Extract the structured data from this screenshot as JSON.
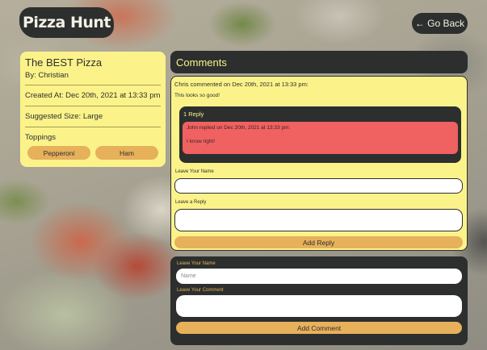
{
  "header": {
    "logo_text": "Pizza Hunt",
    "back_label": "← Go Back"
  },
  "pizza": {
    "title": "The BEST Pizza",
    "by": "By: Christian",
    "created": "Created At: Dec 20th, 2021 at 13:33 pm",
    "size": "Suggested Size: Large",
    "toppings_label": "Toppings",
    "toppings": [
      "Pepperoni",
      "Ham"
    ]
  },
  "comments": {
    "header": "Comments",
    "items": [
      {
        "meta": "Chris commented on Dec 20th, 2021 at 13:33 pm:",
        "text": "This looks so good!",
        "replies_title": "1 Reply",
        "replies": [
          {
            "meta": "John replied on Dec 20th, 2021 at 13:33 pm:",
            "text": "I know right!"
          }
        ],
        "reply_form": {
          "name_label": "Leave Your Name",
          "name_value": "",
          "reply_label": "Leave a Reply",
          "reply_value": "",
          "submit_label": "Add Reply"
        }
      }
    ]
  },
  "new_comment": {
    "name_label": "Leave Your Name",
    "name_placeholder": "Name",
    "comment_label": "Leave Your Comment",
    "comment_value": "",
    "submit_label": "Add Comment"
  },
  "colors": {
    "dark": "#2c2f2e",
    "yellow": "#fbf38a",
    "orange": "#e7b05a",
    "red": "#f06161"
  }
}
